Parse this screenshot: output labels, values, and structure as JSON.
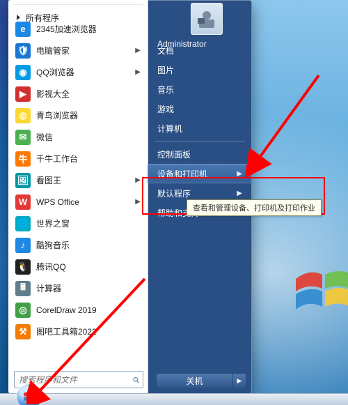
{
  "user": {
    "name": "Administrator"
  },
  "left_menu": {
    "items": [
      {
        "label": "2345加速浏览器",
        "color": "#1e88e5",
        "glyph": "e",
        "arrow": false
      },
      {
        "label": "电脑管家",
        "color": "#1976d2",
        "glyph": "🛡",
        "arrow": true
      },
      {
        "label": "QQ浏览器",
        "color": "#039be5",
        "glyph": "◉",
        "arrow": true
      },
      {
        "label": "影视大全",
        "color": "#d32f2f",
        "glyph": "▶",
        "arrow": false
      },
      {
        "label": "青鸟浏览器",
        "color": "#fdd835",
        "glyph": "◎",
        "arrow": false
      },
      {
        "label": "微信",
        "color": "#4caf50",
        "glyph": "✉",
        "arrow": false
      },
      {
        "label": "千牛工作台",
        "color": "#ff7900",
        "glyph": "牛",
        "arrow": false
      },
      {
        "label": "看图王",
        "color": "#0097a7",
        "glyph": "🖼",
        "arrow": true
      },
      {
        "label": "WPS Office",
        "color": "#e53935",
        "glyph": "W",
        "arrow": true
      },
      {
        "label": "世界之窗",
        "color": "#00acc1",
        "glyph": "🌐",
        "arrow": false
      },
      {
        "label": "酷狗音乐",
        "color": "#1e88e5",
        "glyph": "♪",
        "arrow": false
      },
      {
        "label": "腾讯QQ",
        "color": "#212121",
        "glyph": "🐧",
        "arrow": false
      },
      {
        "label": "计算器",
        "color": "#607d8b",
        "glyph": "🖩",
        "arrow": false
      },
      {
        "label": "CorelDraw 2019",
        "color": "#43a047",
        "glyph": "◎",
        "arrow": false
      },
      {
        "label": "图吧工具箱2022",
        "color": "#f57c00",
        "glyph": "⚒",
        "arrow": false
      }
    ],
    "all_programs": "所有程序"
  },
  "search": {
    "placeholder": "搜索程序和文件"
  },
  "right_menu": {
    "items": [
      {
        "label": "文档"
      },
      {
        "label": "图片"
      },
      {
        "label": "音乐"
      },
      {
        "label": "游戏"
      },
      {
        "label": "计算机"
      },
      {
        "sep": true
      },
      {
        "label": "控制面板"
      },
      {
        "label": "设备和打印机",
        "chev": true,
        "highlight": true
      },
      {
        "label": "默认程序",
        "chev": true
      },
      {
        "label": "帮助和支持"
      }
    ]
  },
  "tooltip": "查看和管理设备、打印机及打印作业",
  "shutdown": {
    "label": "关机"
  },
  "colors": {
    "annotation": "#ff0000",
    "panel_right": "#2a4f84"
  }
}
